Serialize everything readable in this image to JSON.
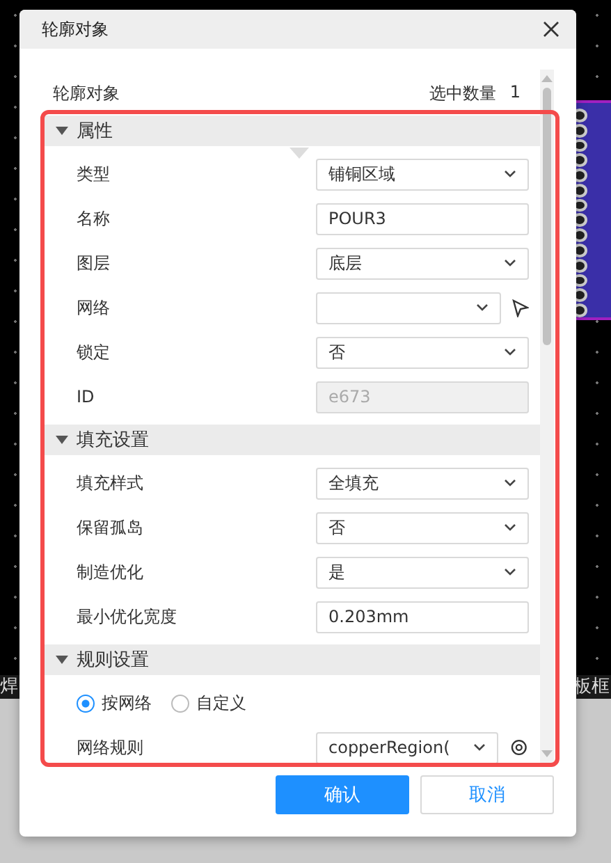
{
  "window": {
    "title": "轮廓对象"
  },
  "header": {
    "label": "轮廓对象",
    "count_label": "选中数量",
    "count": "1"
  },
  "sections": [
    {
      "title": "属性",
      "expanded": true,
      "rows": [
        {
          "kind": "select",
          "label": "类型",
          "value": "铺铜区域"
        },
        {
          "kind": "input",
          "label": "名称",
          "value": "POUR3"
        },
        {
          "kind": "select",
          "label": "图层",
          "value": "底层"
        },
        {
          "kind": "select-picker",
          "label": "网络"
        },
        {
          "kind": "select",
          "label": "锁定",
          "value": "否"
        },
        {
          "kind": "readonly",
          "label": "ID",
          "value": "e673"
        }
      ]
    },
    {
      "title": "填充设置",
      "expanded": true,
      "rows": [
        {
          "kind": "select",
          "label": "填充样式",
          "value": "全填充"
        },
        {
          "kind": "select",
          "label": "保留孤岛",
          "value": "否"
        },
        {
          "kind": "select",
          "label": "制造优化",
          "value": "是"
        },
        {
          "kind": "input",
          "label": "最小优化宽度",
          "value": "0.203mm"
        }
      ]
    },
    {
      "title": "规则设置",
      "expanded": true,
      "rows": [
        {
          "kind": "radio",
          "options": [
            {
              "label": "按网络",
              "selected": true
            },
            {
              "label": "自定义",
              "selected": false
            }
          ]
        },
        {
          "kind": "select-gear",
          "label": "网络规则",
          "value": "copperRegion("
        }
      ]
    }
  ],
  "buttons": [
    {
      "label": "确认",
      "kind": "primary"
    },
    {
      "label": "取消",
      "kind": "secondary"
    }
  ],
  "background_labels": [
    "焊",
    "板框"
  ]
}
